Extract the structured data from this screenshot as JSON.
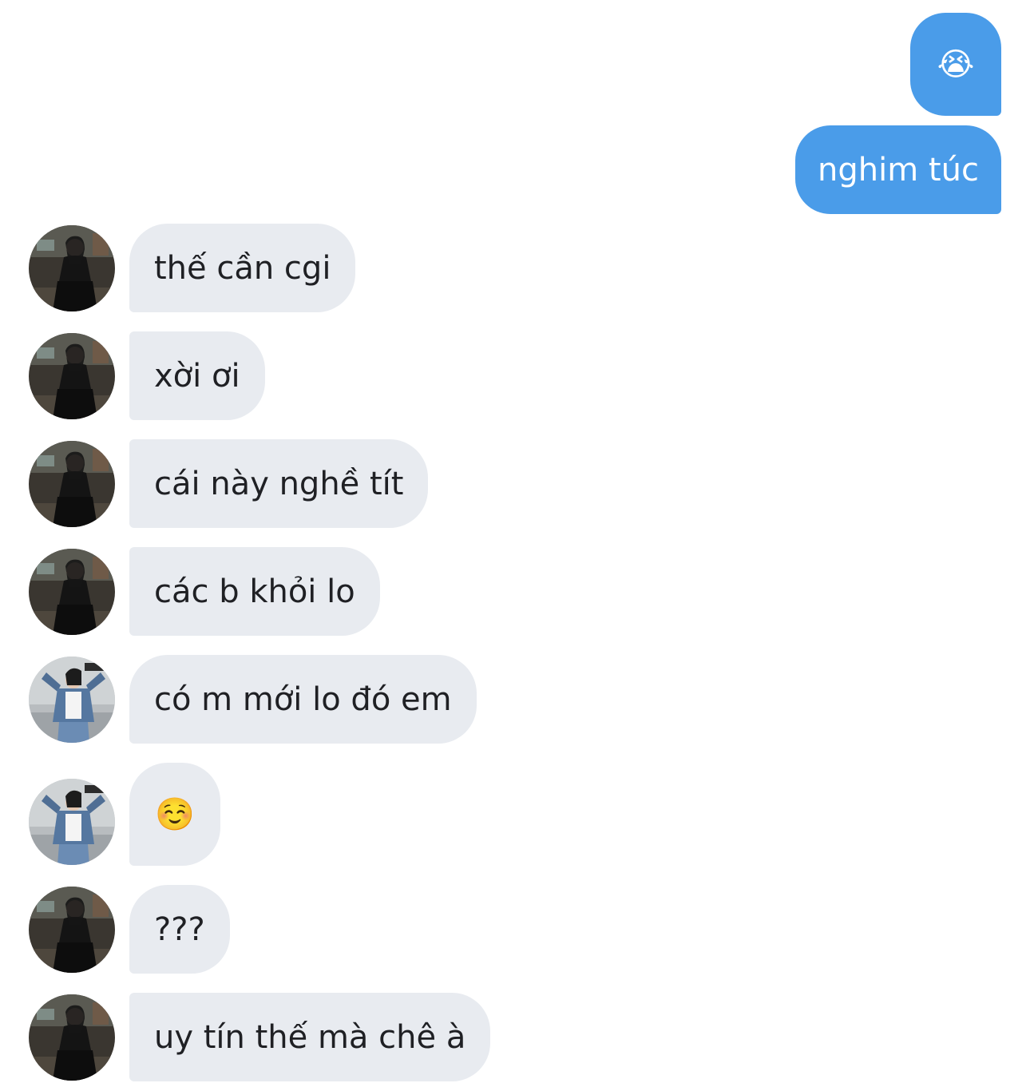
{
  "conversation": {
    "sent": [
      {
        "text": "😭"
      },
      {
        "text": "nghim túc"
      }
    ],
    "received": [
      {
        "text": "thế cần cgi",
        "avatar": "avatar-black-outfit"
      },
      {
        "text": "xời ơi",
        "avatar": "avatar-black-outfit"
      },
      {
        "text": "cái này nghề tít",
        "avatar": "avatar-black-outfit"
      },
      {
        "text": "các b khỏi lo",
        "avatar": "avatar-black-outfit"
      },
      {
        "text": "có m mới lo đó em",
        "avatar": "avatar-denim-jacket"
      },
      {
        "text": "☺️",
        "avatar": "avatar-denim-jacket"
      },
      {
        "text": "???",
        "avatar": "avatar-black-outfit"
      },
      {
        "text": "uy tín thế mà chê à",
        "avatar": "avatar-black-outfit"
      }
    ]
  },
  "colors": {
    "sent_bubble": "#4a9ce9",
    "received_bubble": "#e8ebf0",
    "received_text": "#1f2024",
    "background": "#ffffff"
  }
}
